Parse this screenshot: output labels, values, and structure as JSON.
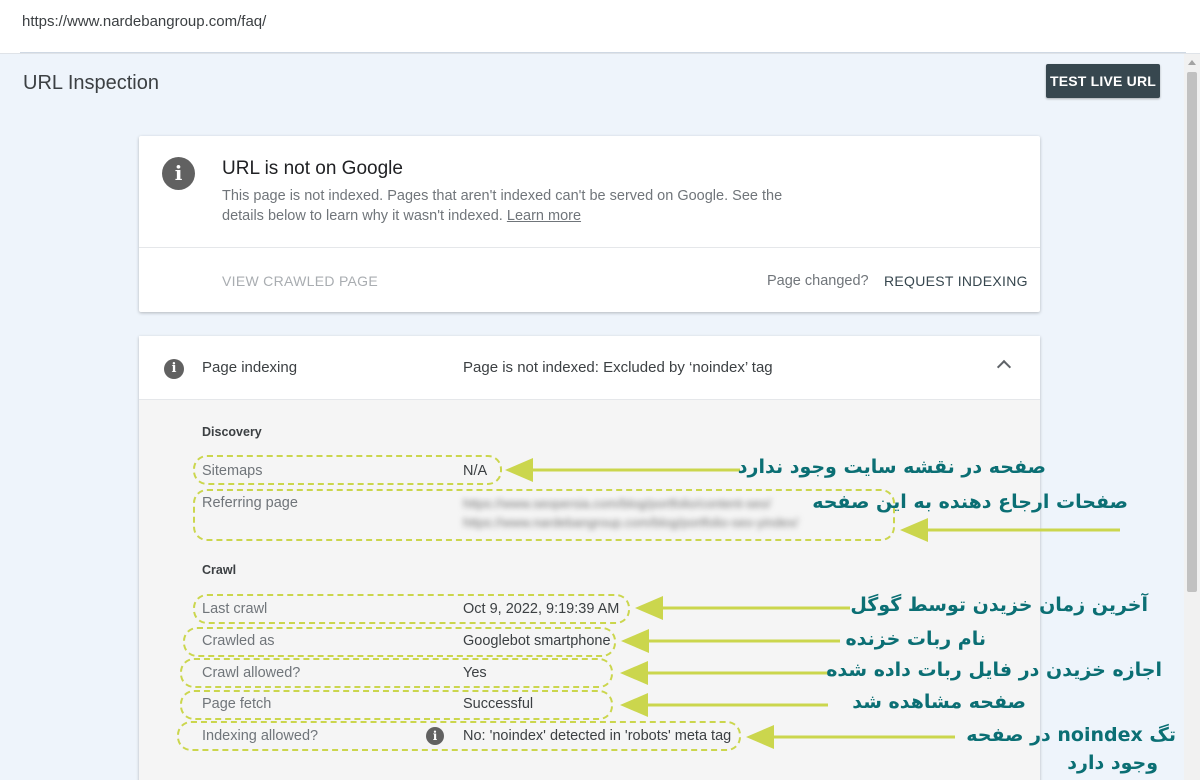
{
  "url_bar": {
    "url": "https://www.nardebangroup.com/faq/"
  },
  "header": {
    "title": "URL Inspection",
    "test_live_button": "TEST LIVE URL"
  },
  "status_card": {
    "icon": "info-icon",
    "title": "URL is not on Google",
    "description": "This page is not indexed. Pages that aren't indexed can't be served on Google. See the details below to learn why it wasn't indexed.",
    "learn_more": "Learn more",
    "view_crawled_page": "VIEW CRAWLED PAGE",
    "page_changed": "Page changed?",
    "request_indexing": "REQUEST INDEXING"
  },
  "indexing_card": {
    "icon": "info-icon",
    "label": "Page indexing",
    "status": "Page is not indexed: Excluded by ‘noindex’ tag",
    "sections": {
      "discovery": {
        "title": "Discovery",
        "sitemaps_label": "Sitemaps",
        "sitemaps_value": "N/A",
        "referring_label": "Referring page",
        "referring_values": [
          "https://www.seopersia.com/blog/portfolio/content-seo/",
          "https://www.nardebangroup.com/blog/portfolio-seo-yindex/"
        ]
      },
      "crawl": {
        "title": "Crawl",
        "last_crawl_label": "Last crawl",
        "last_crawl_value": "Oct 9, 2022, 9:19:39 AM",
        "crawled_as_label": "Crawled as",
        "crawled_as_value": "Googlebot smartphone",
        "crawl_allowed_label": "Crawl allowed?",
        "crawl_allowed_value": "Yes",
        "page_fetch_label": "Page fetch",
        "page_fetch_value": "Successful",
        "indexing_allowed_label": "Indexing allowed?",
        "indexing_allowed_value": "No: 'noindex' detected in 'robots' meta tag"
      }
    }
  },
  "annotations": {
    "sitemap": "صفحه در نقشه سایت وجود ندارد",
    "referring": "صفحات ارجاع دهنده به این صفحه",
    "last_crawl": "آخرین زمان خزیدن توسط گوگل",
    "crawled_as": "نام ربات خزنده",
    "crawl_allowed": "اجازه خزیدن در فایل ربات داده شده",
    "page_fetch": "صفحه مشاهده شد",
    "noindex_line1": "تگ noindex در صفحه",
    "noindex_line2": "وجود دارد"
  },
  "colors": {
    "annotation_text": "#0b6f74",
    "annotation_arrow": "#cbd64d",
    "button_dark": "#37474f"
  }
}
